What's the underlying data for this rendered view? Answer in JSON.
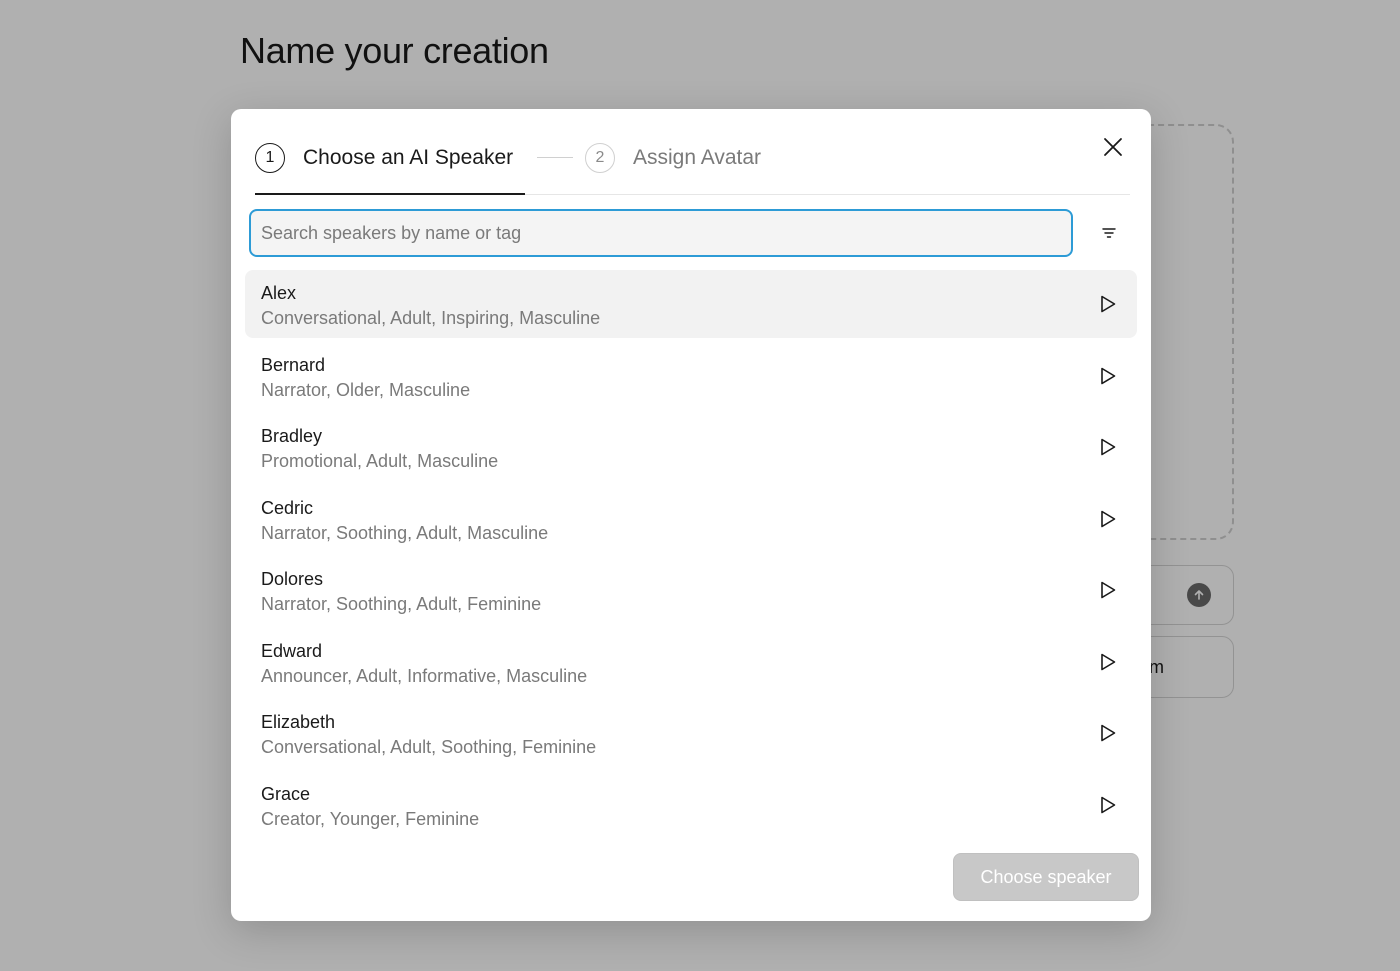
{
  "page": {
    "title": "Name your creation",
    "bg_button_fragment": "m"
  },
  "modal": {
    "steps": [
      {
        "number": "1",
        "label": "Choose an AI Speaker",
        "state": "active"
      },
      {
        "number": "2",
        "label": "Assign Avatar",
        "state": "inactive"
      }
    ],
    "search": {
      "placeholder": "Search speakers by name or tag",
      "value": ""
    },
    "speakers": [
      {
        "name": "Alex",
        "tags": "Conversational, Adult, Inspiring, Masculine",
        "selected": true
      },
      {
        "name": "Bernard",
        "tags": "Narrator, Older, Masculine",
        "selected": false
      },
      {
        "name": "Bradley",
        "tags": "Promotional, Adult, Masculine",
        "selected": false
      },
      {
        "name": "Cedric",
        "tags": "Narrator, Soothing, Adult, Masculine",
        "selected": false
      },
      {
        "name": "Dolores",
        "tags": "Narrator, Soothing, Adult, Feminine",
        "selected": false
      },
      {
        "name": "Edward",
        "tags": "Announcer, Adult, Informative, Masculine",
        "selected": false
      },
      {
        "name": "Elizabeth",
        "tags": "Conversational, Adult, Soothing, Feminine",
        "selected": false
      },
      {
        "name": "Grace",
        "tags": "Creator, Younger, Feminine",
        "selected": false
      }
    ],
    "choose_button_label": "Choose speaker",
    "choose_button_enabled": false
  },
  "colors": {
    "accent_focus": "#2d9bd6",
    "selected_row": "#f2f2f2",
    "disabled_button": "#c8c8c8"
  },
  "icons": {
    "close": "close-icon",
    "filter": "filter-icon",
    "play": "play-icon",
    "upload": "arrow-up-icon"
  }
}
